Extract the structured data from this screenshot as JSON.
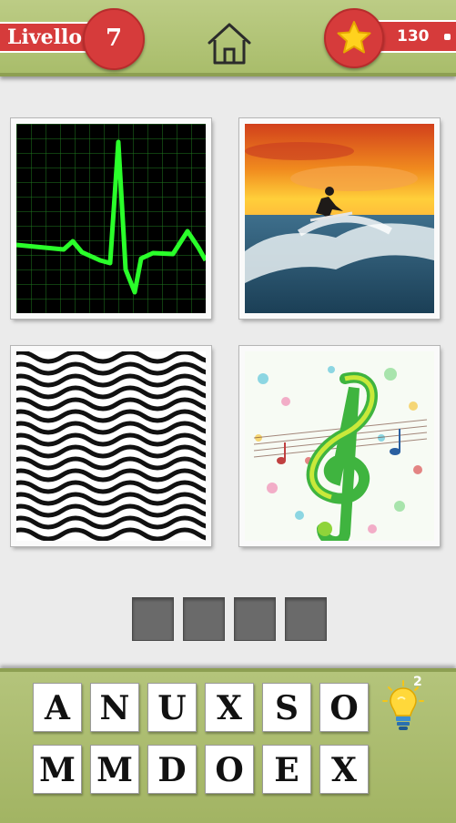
{
  "header": {
    "level_label": "Livello",
    "level_number": "7",
    "coins": "130",
    "home_icon": "home-icon",
    "star_icon": "star-icon"
  },
  "pictures": [
    {
      "name": "heartbeat-ekg"
    },
    {
      "name": "surfer-on-wave"
    },
    {
      "name": "wavy-lines-pattern"
    },
    {
      "name": "music-treble-clef"
    }
  ],
  "answer": {
    "slots": 4,
    "filled": [
      "",
      "",
      "",
      ""
    ]
  },
  "letters": {
    "row1": [
      "A",
      "N",
      "U",
      "X",
      "S",
      "O"
    ],
    "row2": [
      "M",
      "M",
      "D",
      "O",
      "E",
      "X"
    ]
  },
  "hint": {
    "count": "2",
    "icon": "lightbulb-icon"
  },
  "colors": {
    "header_green": "#b2c47a",
    "badge_red": "#d63b3b",
    "slot_gray": "#6a6a6a",
    "background": "#ebebeb"
  }
}
